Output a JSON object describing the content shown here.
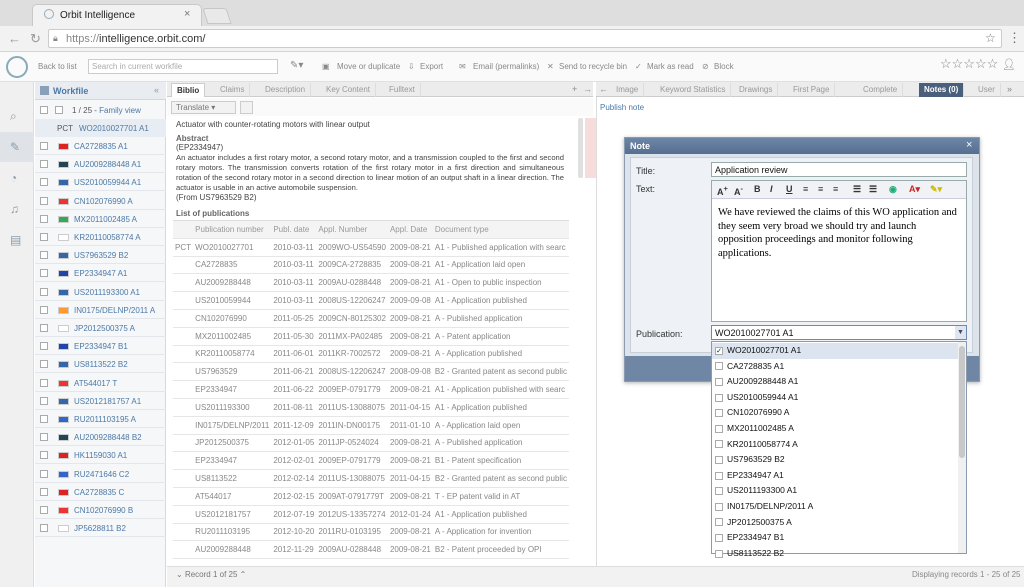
{
  "browser": {
    "tab_title": "Orbit Intelligence",
    "tab_close": "×",
    "url_scheme": "https://",
    "url_host": "intelligence.orbit.com/"
  },
  "toolbar": {
    "back_to_list": "Back to list",
    "search_placeholder": "Search in current workfile",
    "move_or_duplicate": "Move or duplicate",
    "export": "Export",
    "email": "Email (permalinks)",
    "recycle": "Send to recycle bin",
    "mark_read": "Mark as read",
    "block": "Block"
  },
  "workfile": {
    "title": "Workfile",
    "count": "1 / 25",
    "family_view": "Family view",
    "pct": "PCT",
    "pct_number": "WO2010027701 A1",
    "items": [
      {
        "number": "CA2728835 A1",
        "flag": "#d22"
      },
      {
        "number": "AU2009288448 A1",
        "flag": "#245"
      },
      {
        "number": "US2010059944 A1",
        "flag": "#36a"
      },
      {
        "number": "CN102076990 A",
        "flag": "#e33"
      },
      {
        "number": "MX2011002485 A",
        "flag": "#3a5"
      },
      {
        "number": "KR20110058774 A",
        "flag": "#fff"
      },
      {
        "number": "US7963529 B2",
        "flag": "#36a"
      },
      {
        "number": "EP2334947 A1",
        "flag": "#24a"
      },
      {
        "number": "US2011193300 A1",
        "flag": "#36a"
      },
      {
        "number": "IN0175/DELNP/2011 A",
        "flag": "#f93"
      },
      {
        "number": "JP2012500375 A",
        "flag": "#fff"
      },
      {
        "number": "EP2334947 B1",
        "flag": "#24a"
      },
      {
        "number": "US8113522 B2",
        "flag": "#36a"
      },
      {
        "number": "AT544017 T",
        "flag": "#e33"
      },
      {
        "number": "US2012181757 A1",
        "flag": "#36a"
      },
      {
        "number": "RU2011103195 A",
        "flag": "#36c"
      },
      {
        "number": "AU2009288448 B2",
        "flag": "#245"
      },
      {
        "number": "HK1159030 A1",
        "flag": "#d22"
      },
      {
        "number": "RU2471646 C2",
        "flag": "#36c"
      },
      {
        "number": "CA2728835 C",
        "flag": "#d22"
      },
      {
        "number": "CN102076990 B",
        "flag": "#e33"
      },
      {
        "number": "JP5628811 B2",
        "flag": "#fff"
      }
    ]
  },
  "tabs": {
    "biblio": "Biblio",
    "claims": "Claims",
    "description": "Description",
    "key_content": "Key Content",
    "fulltext": "Fulltext",
    "image": "Image",
    "keyword_statistics": "Keyword Statistics",
    "drawings": "Drawings",
    "first_page": "First Page",
    "complete": "Complete",
    "notes": "Notes (0)",
    "user": "User"
  },
  "biblio": {
    "translate": "Translate",
    "subtitle": "Actuator with counter-rotating motors with linear output",
    "abstract_label": "Abstract",
    "abstract_ref": "(EP2334947)",
    "abstract_text": "An actuator includes a first rotary motor, a second rotary motor, and a transmission coupled to the first and second rotary motors. The transmission converts rotation of the first rotary motor in a first direction and simultaneous rotation of the second rotary motor in a second direction to linear motion of an output shaft in a linear direction. The actuator is usable in an active automobile suspension.",
    "from": "(From US7963529 B2)",
    "list_title": "List of publications",
    "columns": [
      "Publication number",
      "Publ. date",
      "Appl. Number",
      "Appl. Date",
      "Document type"
    ],
    "rows": [
      {
        "pre": "PCT",
        "number": "WO2010027701",
        "pdate": "2010-03-11",
        "appl": "2009WO-US54590",
        "adate": "2009-08-21",
        "type": "A1 - Published application with searc"
      },
      {
        "pre": "",
        "number": "CA2728835",
        "pdate": "2010-03-11",
        "appl": "2009CA-2728835",
        "adate": "2009-08-21",
        "type": "A1 - Application laid open"
      },
      {
        "pre": "",
        "number": "AU2009288448",
        "pdate": "2010-03-11",
        "appl": "2009AU-0288448",
        "adate": "2009-08-21",
        "type": "A1 - Open to public inspection"
      },
      {
        "pre": "",
        "number": "US2010059944",
        "pdate": "2010-03-11",
        "appl": "2008US-12206247",
        "adate": "2009-09-08",
        "type": "A1 - Application published"
      },
      {
        "pre": "",
        "number": "CN102076990",
        "pdate": "2011-05-25",
        "appl": "2009CN-80125302",
        "adate": "2009-08-21",
        "type": "A - Published application"
      },
      {
        "pre": "",
        "number": "MX2011002485",
        "pdate": "2011-05-30",
        "appl": "2011MX-PA02485",
        "adate": "2009-08-21",
        "type": "A - Patent application"
      },
      {
        "pre": "",
        "number": "KR20110058774",
        "pdate": "2011-06-01",
        "appl": "2011KR-7002572",
        "adate": "2009-08-21",
        "type": "A - Application published"
      },
      {
        "pre": "",
        "number": "US7963529",
        "pdate": "2011-06-21",
        "appl": "2008US-12206247",
        "adate": "2008-09-08",
        "type": "B2 - Granted patent as second public"
      },
      {
        "pre": "",
        "number": "EP2334947",
        "pdate": "2011-06-22",
        "appl": "2009EP-0791779",
        "adate": "2009-08-21",
        "type": "A1 - Application published with searc"
      },
      {
        "pre": "",
        "number": "US2011193300",
        "pdate": "2011-08-11",
        "appl": "2011US-13088075",
        "adate": "2011-04-15",
        "type": "A1 - Application published"
      },
      {
        "pre": "",
        "number": "IN0175/DELNP/2011",
        "pdate": "2011-12-09",
        "appl": "2011IN-DN00175",
        "adate": "2011-01-10",
        "type": "A - Application laid open"
      },
      {
        "pre": "",
        "number": "JP2012500375",
        "pdate": "2012-01-05",
        "appl": "2011JP-0524024",
        "adate": "2009-08-21",
        "type": "A - Published application"
      },
      {
        "pre": "",
        "number": "EP2334947",
        "pdate": "2012-02-01",
        "appl": "2009EP-0791779",
        "adate": "2009-08-21",
        "type": "B1 - Patent specification"
      },
      {
        "pre": "",
        "number": "US8113522",
        "pdate": "2012-02-14",
        "appl": "2011US-13088075",
        "adate": "2011-04-15",
        "type": "B2 - Granted patent as second public"
      },
      {
        "pre": "",
        "number": "AT544017",
        "pdate": "2012-02-15",
        "appl": "2009AT-0791779T",
        "adate": "2009-08-21",
        "type": "T - EP patent valid in AT"
      },
      {
        "pre": "",
        "number": "US2012181757",
        "pdate": "2012-07-19",
        "appl": "2012US-13357274",
        "adate": "2012-01-24",
        "type": "A1 - Application published"
      },
      {
        "pre": "",
        "number": "RU2011103195",
        "pdate": "2012-10-20",
        "appl": "2011RU-0103195",
        "adate": "2009-08-21",
        "type": "A - Application for invention"
      },
      {
        "pre": "",
        "number": "AU2009288448",
        "pdate": "2012-11-29",
        "appl": "2009AU-0288448",
        "adate": "2009-08-21",
        "type": "B2 - Patent proceeded by OPI"
      }
    ]
  },
  "right": {
    "publish_note": "Publish note"
  },
  "note_dialog": {
    "header": "Note",
    "title_label": "Title:",
    "title_value": "Application review",
    "text_label": "Text:",
    "body": "We have reviewed the claims of this WO application and they seem very broad we should try and launch opposition proceedings and monitor following applications.",
    "publication_label": "Publication:",
    "publication_value": "WO2010027701 A1",
    "options": [
      {
        "label": "WO2010027701 A1",
        "checked": true
      },
      {
        "label": "CA2728835 A1",
        "checked": false
      },
      {
        "label": "AU2009288448 A1",
        "checked": false
      },
      {
        "label": "US2010059944 A1",
        "checked": false
      },
      {
        "label": "CN102076990 A",
        "checked": false
      },
      {
        "label": "MX2011002485 A",
        "checked": false
      },
      {
        "label": "KR20110058774 A",
        "checked": false
      },
      {
        "label": "US7963529 B2",
        "checked": false
      },
      {
        "label": "EP2334947 A1",
        "checked": false
      },
      {
        "label": "US2011193300 A1",
        "checked": false
      },
      {
        "label": "IN0175/DELNP/2011 A",
        "checked": false
      },
      {
        "label": "JP2012500375 A",
        "checked": false
      },
      {
        "label": "EP2334947 B1",
        "checked": false
      },
      {
        "label": "US8113522 B2",
        "checked": false
      }
    ]
  },
  "status": {
    "record": "Record 1 of 25",
    "displaying": "Displaying records 1 - 25 of 25"
  }
}
